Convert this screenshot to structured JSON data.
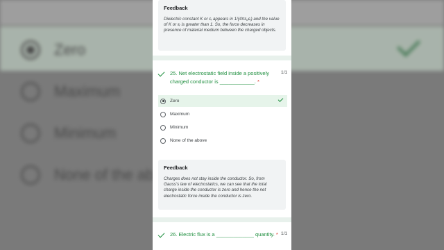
{
  "top_feedback": {
    "title": "Feedback",
    "text": "Dielectric constant K or εᵣ appears in 1/(4πε₀εᵣ) and the value of K or εᵣ is greater than 1. So, the force decreases in presence of material medium between the charged objects."
  },
  "q25": {
    "text": "25. Net electrostatic field inside a positively charged conductor is ____________.",
    "required_mark": "*",
    "score": "1/1",
    "options": [
      "Zero",
      "Maximum",
      "Minimum",
      "None of the above"
    ],
    "selected": "Zero"
  },
  "q25_feedback": {
    "title": "Feedback",
    "text": "Charges does not stay inside the conductor. So, from Gauss's law of electrostatics, we can see that the total charge inside the conductor is zero and hence the net electrostatic force inside the conductor is zero."
  },
  "q26": {
    "text": "26. Electric flux is a _____________ quantity.",
    "required_mark": "*",
    "score": "1/1"
  },
  "background": {
    "options": [
      "Zero",
      "Maximum",
      "Minimum",
      "None of the ab"
    ]
  },
  "colors": {
    "accent_green": "#1e8e3e",
    "selected_bg": "#e6f4ea",
    "required_red": "#d93025"
  }
}
